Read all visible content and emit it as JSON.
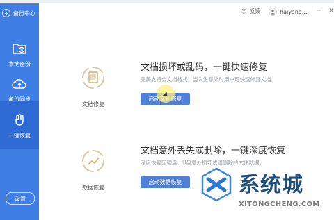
{
  "sidebar": {
    "brand": "备份中心",
    "items": [
      {
        "label": "本地备份"
      },
      {
        "label": "备份同步"
      },
      {
        "label": "一键恢复"
      }
    ],
    "settings_label": "设置"
  },
  "header": {
    "feedback_label": "反馈",
    "user_name": "haiyana..."
  },
  "cards": [
    {
      "icon_label": "文档修复",
      "title": "文档损坏或乱码，一键快速修复",
      "description": "完美支持全文档格式，当发生意外时用户可快速修复文档。",
      "button_label": "启动文档修复"
    },
    {
      "icon_label": "数据恢复",
      "title": "文档意外丢失或删除，一键深度恢复",
      "description": "深度恢复因硬盘、U盘意外损坏或误删除的文件数据。",
      "button_label": "启动数据恢复"
    }
  ],
  "watermark": {
    "text": "系统城",
    "url": "XITONGCHENG.COM"
  },
  "colors": {
    "sidebar": "#3f7fe5",
    "sidebar_active": "#2f6bd4",
    "button": "#4f7fd7"
  }
}
